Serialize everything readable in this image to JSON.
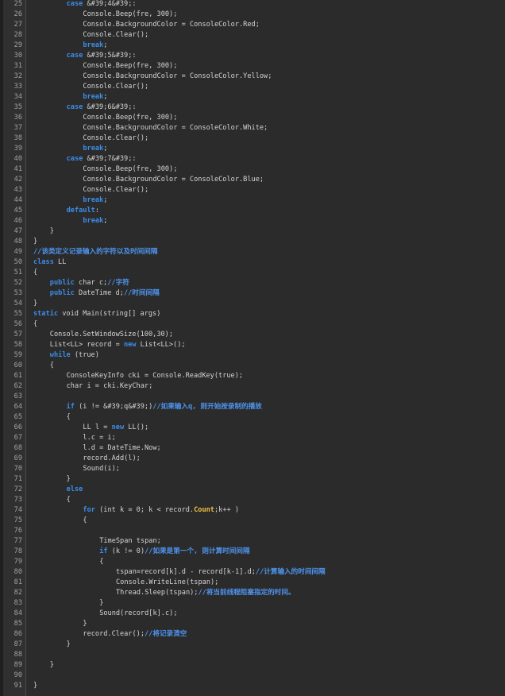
{
  "editor": {
    "lines": [
      {
        "no": "25",
        "segs": [
          {
            "t": "        "
          },
          {
            "t": "case",
            "c": "k"
          },
          {
            "t": " &#39;4&#39;:"
          }
        ]
      },
      {
        "no": "26",
        "segs": [
          {
            "t": "            Console.Beep(fre, 300);"
          }
        ]
      },
      {
        "no": "27",
        "segs": [
          {
            "t": "            Console.BackgroundColor = ConsoleColor.Red;"
          }
        ]
      },
      {
        "no": "28",
        "segs": [
          {
            "t": "            Console.Clear();"
          }
        ]
      },
      {
        "no": "29",
        "segs": [
          {
            "t": "            "
          },
          {
            "t": "break",
            "c": "k"
          },
          {
            "t": ";"
          }
        ]
      },
      {
        "no": "30",
        "segs": [
          {
            "t": "        "
          },
          {
            "t": "case",
            "c": "k"
          },
          {
            "t": " &#39;5&#39;:"
          }
        ]
      },
      {
        "no": "31",
        "segs": [
          {
            "t": "            Console.Beep(fre, 300);"
          }
        ]
      },
      {
        "no": "32",
        "segs": [
          {
            "t": "            Console.BackgroundColor = ConsoleColor.Yellow;"
          }
        ]
      },
      {
        "no": "33",
        "segs": [
          {
            "t": "            Console.Clear();"
          }
        ]
      },
      {
        "no": "34",
        "segs": [
          {
            "t": "            "
          },
          {
            "t": "break",
            "c": "k"
          },
          {
            "t": ";"
          }
        ]
      },
      {
        "no": "35",
        "segs": [
          {
            "t": "        "
          },
          {
            "t": "case",
            "c": "k"
          },
          {
            "t": " &#39;6&#39;:"
          }
        ]
      },
      {
        "no": "36",
        "segs": [
          {
            "t": "            Console.Beep(fre, 300);"
          }
        ]
      },
      {
        "no": "37",
        "segs": [
          {
            "t": "            Console.BackgroundColor = ConsoleColor.White;"
          }
        ]
      },
      {
        "no": "38",
        "segs": [
          {
            "t": "            Console.Clear();"
          }
        ]
      },
      {
        "no": "39",
        "segs": [
          {
            "t": "            "
          },
          {
            "t": "break",
            "c": "k"
          },
          {
            "t": ";"
          }
        ]
      },
      {
        "no": "40",
        "segs": [
          {
            "t": "        "
          },
          {
            "t": "case",
            "c": "k"
          },
          {
            "t": " &#39;7&#39;:"
          }
        ]
      },
      {
        "no": "41",
        "segs": [
          {
            "t": "            Console.Beep(fre, 300);"
          }
        ]
      },
      {
        "no": "42",
        "segs": [
          {
            "t": "            Console.BackgroundColor = ConsoleColor.Blue;"
          }
        ]
      },
      {
        "no": "43",
        "segs": [
          {
            "t": "            Console.Clear();"
          }
        ]
      },
      {
        "no": "44",
        "segs": [
          {
            "t": "            "
          },
          {
            "t": "break",
            "c": "k"
          },
          {
            "t": ";"
          }
        ]
      },
      {
        "no": "45",
        "segs": [
          {
            "t": "        "
          },
          {
            "t": "default",
            "c": "k"
          },
          {
            "t": ":"
          }
        ]
      },
      {
        "no": "46",
        "segs": [
          {
            "t": "            "
          },
          {
            "t": "break",
            "c": "k"
          },
          {
            "t": ";"
          }
        ]
      },
      {
        "no": "47",
        "segs": [
          {
            "t": "    }"
          }
        ]
      },
      {
        "no": "48",
        "segs": [
          {
            "t": "}"
          }
        ]
      },
      {
        "no": "49",
        "segs": [
          {
            "t": "//该类定义记录输入的字符以及时间间隔",
            "c": "c"
          }
        ]
      },
      {
        "no": "50",
        "segs": [
          {
            "t": "class",
            "c": "k"
          },
          {
            "t": " LL"
          }
        ]
      },
      {
        "no": "51",
        "segs": [
          {
            "t": "{"
          }
        ]
      },
      {
        "no": "52",
        "segs": [
          {
            "t": "    "
          },
          {
            "t": "public",
            "c": "k"
          },
          {
            "t": " char c;"
          },
          {
            "t": "//字符",
            "c": "c"
          }
        ]
      },
      {
        "no": "53",
        "segs": [
          {
            "t": "    "
          },
          {
            "t": "public",
            "c": "k"
          },
          {
            "t": " DateTime d;"
          },
          {
            "t": "//时间间隔",
            "c": "c"
          }
        ]
      },
      {
        "no": "54",
        "segs": [
          {
            "t": "}"
          }
        ]
      },
      {
        "no": "55",
        "segs": [
          {
            "t": "static",
            "c": "k"
          },
          {
            "t": " void Main(string[] args)"
          }
        ]
      },
      {
        "no": "56",
        "segs": [
          {
            "t": "{"
          }
        ]
      },
      {
        "no": "57",
        "segs": [
          {
            "t": "    Console.SetWindowSize(100,30);"
          }
        ]
      },
      {
        "no": "58",
        "segs": [
          {
            "t": "    List<LL> record = "
          },
          {
            "t": "new",
            "c": "k"
          },
          {
            "t": " List<LL>();"
          }
        ]
      },
      {
        "no": "59",
        "segs": [
          {
            "t": "    "
          },
          {
            "t": "while",
            "c": "k"
          },
          {
            "t": " (true)"
          }
        ]
      },
      {
        "no": "60",
        "segs": [
          {
            "t": "    {"
          }
        ]
      },
      {
        "no": "61",
        "segs": [
          {
            "t": "        ConsoleKeyInfo cki = Console.ReadKey(true);"
          }
        ]
      },
      {
        "no": "62",
        "segs": [
          {
            "t": "        char i = cki.KeyChar;"
          }
        ]
      },
      {
        "no": "63",
        "segs": [
          {
            "t": ""
          }
        ]
      },
      {
        "no": "64",
        "segs": [
          {
            "t": "        "
          },
          {
            "t": "if",
            "c": "k"
          },
          {
            "t": " (i != &#39;q&#39;)"
          },
          {
            "t": "//如果输入q, 则开始按录制的播放",
            "c": "c"
          }
        ]
      },
      {
        "no": "65",
        "segs": [
          {
            "t": "        {"
          }
        ]
      },
      {
        "no": "66",
        "segs": [
          {
            "t": "            LL l = "
          },
          {
            "t": "new",
            "c": "k"
          },
          {
            "t": " LL();"
          }
        ]
      },
      {
        "no": "67",
        "segs": [
          {
            "t": "            l.c = i;"
          }
        ]
      },
      {
        "no": "68",
        "segs": [
          {
            "t": "            l.d = DateTime.Now;"
          }
        ]
      },
      {
        "no": "69",
        "segs": [
          {
            "t": "            record.Add(l);"
          }
        ]
      },
      {
        "no": "70",
        "segs": [
          {
            "t": "            Sound(i);"
          }
        ]
      },
      {
        "no": "71",
        "segs": [
          {
            "t": "        }"
          }
        ]
      },
      {
        "no": "72",
        "segs": [
          {
            "t": "        "
          },
          {
            "t": "else",
            "c": "k"
          }
        ]
      },
      {
        "no": "73",
        "segs": [
          {
            "t": "        {"
          }
        ]
      },
      {
        "no": "74",
        "segs": [
          {
            "t": "            "
          },
          {
            "t": "for",
            "c": "k"
          },
          {
            "t": " (int k = 0; k < record."
          },
          {
            "t": "Count",
            "c": "y"
          },
          {
            "t": ";k++ )"
          }
        ]
      },
      {
        "no": "75",
        "segs": [
          {
            "t": "            {"
          }
        ]
      },
      {
        "no": "76",
        "segs": [
          {
            "t": ""
          }
        ]
      },
      {
        "no": "77",
        "segs": [
          {
            "t": "                TimeSpan tspan;"
          }
        ]
      },
      {
        "no": "78",
        "segs": [
          {
            "t": "                "
          },
          {
            "t": "if",
            "c": "k"
          },
          {
            "t": " (k != 0)"
          },
          {
            "t": "//如果是第一个, 则计算时间间隔",
            "c": "c"
          }
        ]
      },
      {
        "no": "79",
        "segs": [
          {
            "t": "                {"
          }
        ]
      },
      {
        "no": "80",
        "segs": [
          {
            "t": "                    tspan=record[k].d - record[k-1].d;"
          },
          {
            "t": "//计算输入的时间间隔",
            "c": "c"
          }
        ]
      },
      {
        "no": "81",
        "segs": [
          {
            "t": "                    Console.WriteLine(tspan);"
          }
        ]
      },
      {
        "no": "82",
        "segs": [
          {
            "t": "                    Thread.Sleep(tspan);"
          },
          {
            "t": "//将当前线程阻塞指定的时间。",
            "c": "c"
          }
        ]
      },
      {
        "no": "83",
        "segs": [
          {
            "t": "                }"
          }
        ]
      },
      {
        "no": "84",
        "segs": [
          {
            "t": "                Sound(record[k].c);"
          }
        ]
      },
      {
        "no": "85",
        "segs": [
          {
            "t": "            }"
          }
        ]
      },
      {
        "no": "86",
        "segs": [
          {
            "t": "            record.Clear();"
          },
          {
            "t": "//将记录清空",
            "c": "c"
          }
        ]
      },
      {
        "no": "87",
        "segs": [
          {
            "t": "        }"
          }
        ]
      },
      {
        "no": "88",
        "segs": [
          {
            "t": ""
          }
        ]
      },
      {
        "no": "89",
        "segs": [
          {
            "t": "    }"
          }
        ]
      },
      {
        "no": "90",
        "segs": [
          {
            "t": ""
          }
        ]
      },
      {
        "no": "91",
        "segs": [
          {
            "t": "}"
          }
        ]
      }
    ]
  },
  "colors": {
    "background": "#2b2b2b",
    "gutter": "#303030",
    "keyword": "#3c8ce8",
    "comment": "#4e94ef",
    "property": "#f0c040",
    "text": "#d4d4d4",
    "line_number": "#a0a0a0"
  }
}
